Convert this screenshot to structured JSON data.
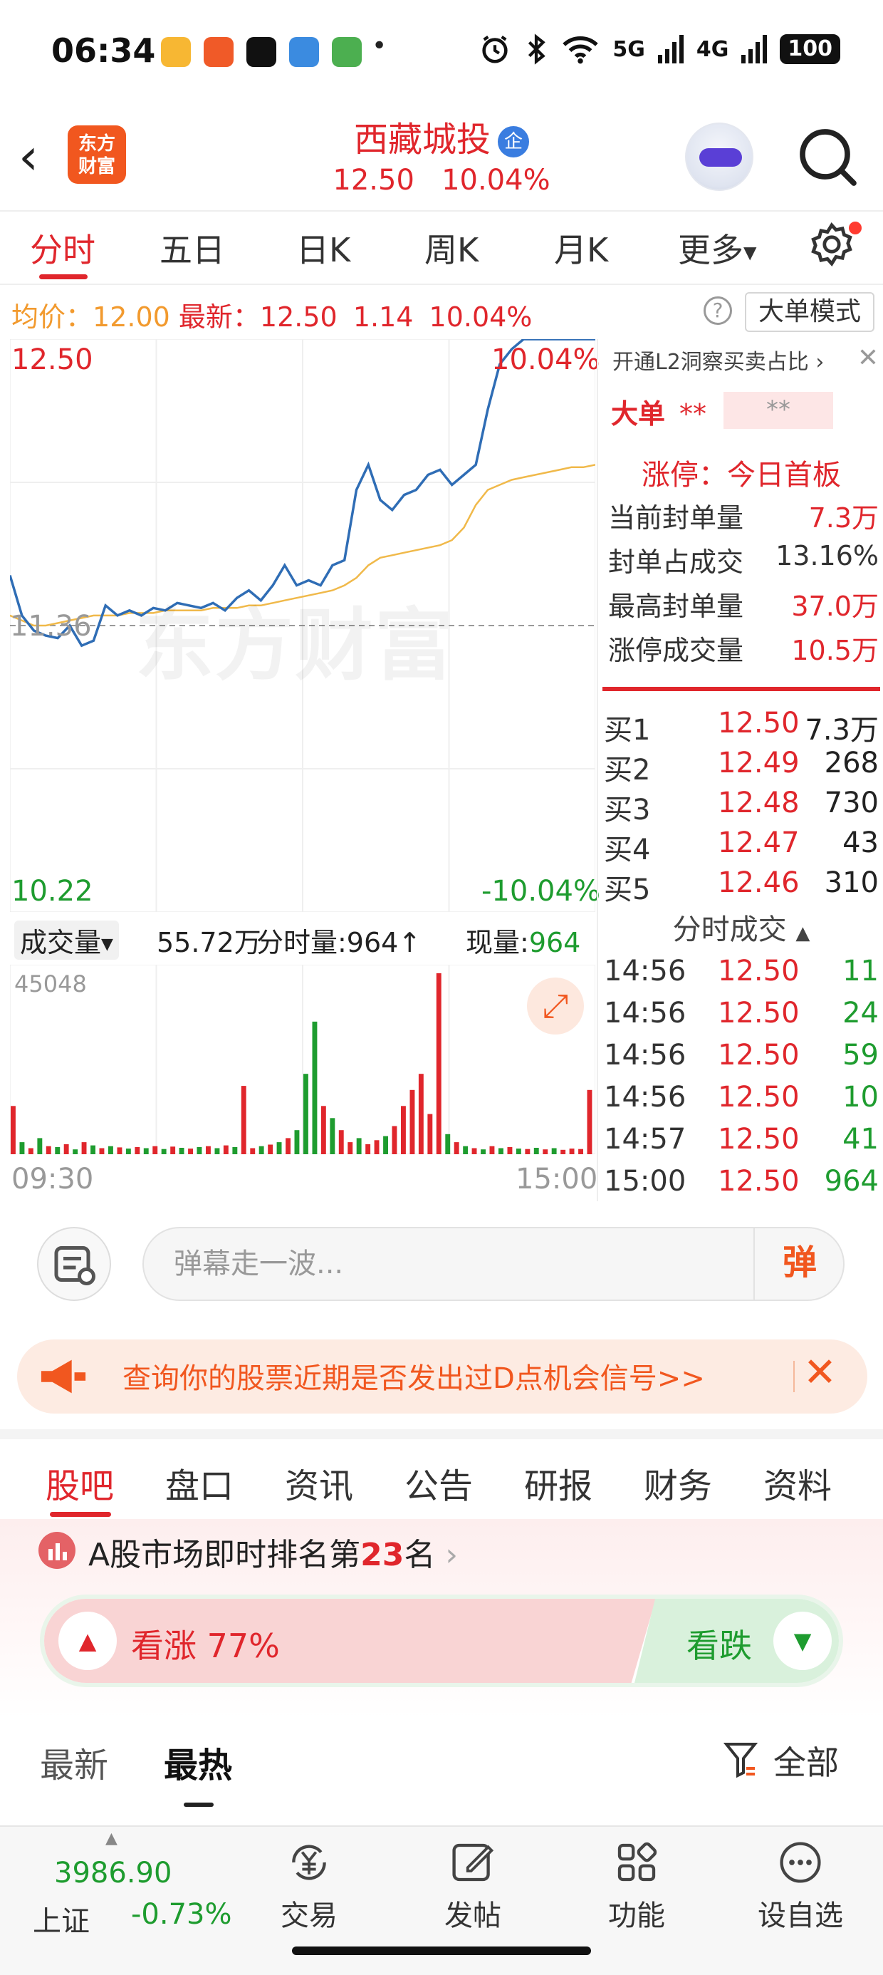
{
  "status_bar": {
    "time": "06:34",
    "dot": "•",
    "signal_5g": "5G",
    "signal_4g": "4G",
    "battery": "100"
  },
  "header": {
    "brand_logo": "东方\n财富",
    "stock_name": "西藏城投",
    "corp_badge": "企",
    "price": "12.50",
    "change_pct": "10.04%"
  },
  "period_tabs": [
    "分时",
    "五日",
    "日K",
    "周K",
    "月K",
    "更多"
  ],
  "info_bar": {
    "avg_label": "均价：",
    "avg_value": "12.00",
    "latest_label": "最新：",
    "latest_value": "12.50",
    "change": "1.14",
    "change_pct": "10.04%",
    "help": "?",
    "mode_button": "大单模式"
  },
  "chart": {
    "label_high": "12.50",
    "label_pct_high": "10.04%",
    "label_mid": "11.36",
    "label_low": "10.22",
    "label_pct_low": "-10.04%",
    "watermark": "东方财富",
    "colors": {
      "price_line": "#2f6db5",
      "avg_line": "#f0b94a",
      "up": "#e0262c",
      "down": "#1e9c2f"
    }
  },
  "chart_data": {
    "type": "line",
    "x_range": [
      "09:30",
      "15:00"
    ],
    "ylim": [
      10.22,
      12.5
    ],
    "baseline": 11.36,
    "series": [
      {
        "values": [
          11.56,
          11.4,
          11.34,
          11.32,
          11.31,
          11.36,
          11.28,
          11.3,
          11.44,
          11.4,
          11.42,
          11.4,
          11.43,
          11.42,
          11.45,
          11.44,
          11.43,
          11.45,
          11.42,
          11.47,
          11.5,
          11.46,
          11.52,
          11.6,
          11.52,
          11.54,
          11.52,
          11.6,
          11.62,
          11.9,
          12.0,
          11.86,
          11.82,
          11.88,
          11.9,
          11.96,
          11.98,
          11.92,
          11.96,
          12.0,
          12.22,
          12.4,
          12.46,
          12.5,
          12.5,
          12.5,
          12.5,
          12.5,
          12.5,
          12.5
        ]
      },
      {
        "values": [
          11.4,
          11.38,
          11.36,
          11.36,
          11.37,
          11.38,
          11.39,
          11.4,
          11.4,
          11.4,
          11.41,
          11.41,
          11.41,
          11.42,
          11.42,
          11.42,
          11.42,
          11.43,
          11.43,
          11.43,
          11.44,
          11.44,
          11.45,
          11.46,
          11.47,
          11.48,
          11.49,
          11.5,
          11.52,
          11.55,
          11.6,
          11.63,
          11.64,
          11.65,
          11.66,
          11.67,
          11.68,
          11.7,
          11.75,
          11.84,
          11.9,
          11.92,
          11.94,
          11.95,
          11.96,
          11.97,
          11.98,
          11.99,
          11.99,
          12.0
        ]
      }
    ],
    "volume": {
      "max": 45048,
      "values": [
        12000,
        3000,
        1500,
        4000,
        2000,
        1800,
        2500,
        1200,
        3000,
        2200,
        1500,
        2000,
        1700,
        1400,
        1800,
        1500,
        2000,
        1300,
        1900,
        1600,
        1400,
        1800,
        2000,
        1500,
        2200,
        1800,
        17000,
        1500,
        2000,
        2400,
        3000,
        4000,
        6000,
        20000,
        33000,
        12000,
        9000,
        6000,
        3000,
        4000,
        2500,
        3500,
        4500,
        7000,
        12000,
        16000,
        20000,
        10000,
        45048,
        5000,
        3000,
        2000,
        1500,
        1200,
        2000,
        1500,
        1800,
        1400,
        1300,
        1600,
        1200,
        1500,
        1100,
        1400,
        1300,
        16000
      ],
      "up": [
        1,
        0,
        1,
        0,
        1,
        0,
        1,
        0,
        1,
        0,
        1,
        0,
        1,
        0,
        1,
        0,
        1,
        0,
        1,
        0,
        1,
        0,
        1,
        0,
        1,
        0,
        1,
        1,
        0,
        1,
        0,
        1,
        0,
        0,
        0,
        1,
        0,
        1,
        1,
        0,
        1,
        1,
        0,
        1,
        1,
        1,
        1,
        1,
        1,
        0,
        1,
        0,
        1,
        0,
        1,
        0,
        1,
        0,
        1,
        0,
        1,
        0,
        1,
        1,
        1,
        1
      ]
    }
  },
  "volume_info": {
    "select": "成交量",
    "total": "55.72万",
    "period_label": "分时量:964↑",
    "current_label": "现量:",
    "current_value": "964",
    "max_label": "45048",
    "time_start": "09:30",
    "time_end": "15:00"
  },
  "right_panel": {
    "l2_banner": "开通L2洞察买卖占比",
    "big_order_label": "大单",
    "big_order_mask1": "**",
    "big_order_mask2": "**",
    "limit_title": "涨停：今日首板",
    "stats": [
      {
        "label": "当前封单量",
        "value": "7.3万",
        "color": "red"
      },
      {
        "label": "封单占成交",
        "value": "13.16%",
        "color": "black"
      },
      {
        "label": "最高封单量",
        "value": "37.0万",
        "color": "red"
      },
      {
        "label": "涨停成交量",
        "value": "10.5万",
        "color": "red"
      }
    ],
    "bids": [
      {
        "label": "买1",
        "price": "12.50",
        "qty": "7.3万"
      },
      {
        "label": "买2",
        "price": "12.49",
        "qty": "268"
      },
      {
        "label": "买3",
        "price": "12.48",
        "qty": "730"
      },
      {
        "label": "买4",
        "price": "12.47",
        "qty": "43"
      },
      {
        "label": "买5",
        "price": "12.46",
        "qty": "310"
      }
    ],
    "trades_header": "分时成交",
    "trades": [
      {
        "time": "14:56",
        "price": "12.50",
        "qty": "11"
      },
      {
        "time": "14:56",
        "price": "12.50",
        "qty": "24"
      },
      {
        "time": "14:56",
        "price": "12.50",
        "qty": "59"
      },
      {
        "time": "14:56",
        "price": "12.50",
        "qty": "10"
      },
      {
        "time": "14:57",
        "price": "12.50",
        "qty": "41"
      },
      {
        "time": "15:00",
        "price": "12.50",
        "qty": "964"
      }
    ]
  },
  "comment_bar": {
    "placeholder": "弹幕走一波...",
    "danmu_button": "弹"
  },
  "promo": {
    "text": "查询你的股票近期是否发出过D点机会信号>>"
  },
  "section_tabs": [
    "股吧",
    "盘口",
    "资讯",
    "公告",
    "研报",
    "财务",
    "资料"
  ],
  "ranking": {
    "prefix": "A股市场即时排名第",
    "rank": "23",
    "suffix": "名"
  },
  "sentiment": {
    "bull_label": "看涨 77%",
    "bull_ratio": 0.77,
    "bear_label": "看跌"
  },
  "feed_tabs": {
    "latest": "最新",
    "hot": "最热",
    "filter": "全部"
  },
  "bottom_nav": {
    "index_value": "3986.90",
    "index_name": "上证",
    "index_change": "-0.73%",
    "items": [
      {
        "label": "交易",
        "icon": "yen-exchange-icon"
      },
      {
        "label": "发帖",
        "icon": "edit-icon"
      },
      {
        "label": "功能",
        "icon": "grid-icon"
      },
      {
        "label": "设自选",
        "icon": "more-circle-icon"
      }
    ]
  }
}
